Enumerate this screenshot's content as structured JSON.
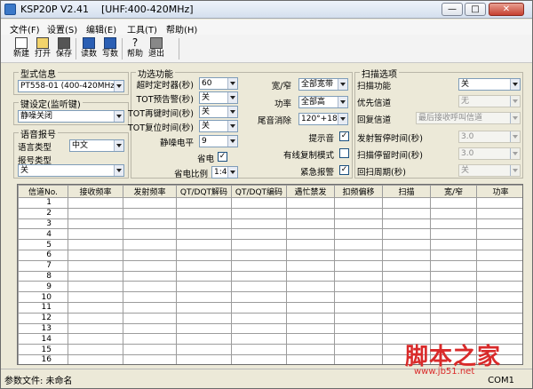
{
  "window": {
    "title": "KSP20P V2.41    [UHF:400-420MHz]",
    "min_label": "—",
    "max_label": "□",
    "close_label": "✕"
  },
  "menu": [
    "文件(F)",
    "设置(S)",
    "编辑(E)",
    "工具(T)",
    "帮助(H)"
  ],
  "toolbar": {
    "new": "新建",
    "open": "打开",
    "save": "保存",
    "read": "读数",
    "write": "写数",
    "help": "帮助",
    "exit": "退出"
  },
  "model": {
    "title": "型式信息",
    "value": "PT558-01 (400-420MHz)"
  },
  "key": {
    "title": "键设定(监听键)",
    "value": "静噪关闭"
  },
  "voice": {
    "title": "语音报号",
    "lang_label": "语言类型",
    "lang_value": "中文",
    "report_label": "报号类型",
    "report_value": "关"
  },
  "func": {
    "title": "功选功能",
    "timeout_label": "超时定时器(秒)",
    "timeout_value": "60",
    "tot_prealert_label": "TOT预告警(秒)",
    "tot_prealert_value": "关",
    "tot_rekey_label": "TOT再键时间(秒)",
    "tot_rekey_value": "关",
    "tot_reset_label": "TOT复位时间(秒)",
    "tot_reset_value": "关",
    "squelch_label": "静噪电平",
    "squelch_value": "9",
    "powersave_label": "省电",
    "powersave_checked": true,
    "ratio_label": "省电比例",
    "ratio_value": "1:4",
    "bw_label": "宽/窄",
    "bw_value": "全部宽带",
    "power_label": "功率",
    "power_value": "全部高",
    "tail_label": "尾音消除",
    "tail_value": "120°+180°",
    "beep_label": "提示音",
    "beep_checked": true,
    "clone_label": "有线复制模式",
    "clone_checked": false,
    "alarm_label": "紧急报警",
    "alarm_checked": true
  },
  "scan": {
    "title": "扫描选项",
    "func_label": "扫描功能",
    "func_value": "关",
    "priority_label": "优先信道",
    "priority_value": "无",
    "revert_label": "回复信道",
    "revert_value": "最后接收呼叫信道",
    "tx_pause_label": "发射暂停时间(秒)",
    "tx_pause_value": "3.0",
    "rx_pause_label": "扫描停留时间(秒)",
    "rx_pause_value": "3.0",
    "lookback_label": "回扫周期(秒)",
    "lookback_value": "关"
  },
  "table": {
    "columns": [
      "信道No.",
      "接收频率",
      "发射频率",
      "QT/DQT解码",
      "QT/DQT编码",
      "遇忙禁发",
      "扣频偏移",
      "扫描",
      "宽/窄",
      "功率"
    ],
    "rows": [
      "1",
      "2",
      "3",
      "4",
      "5",
      "6",
      "7",
      "8",
      "9",
      "10",
      "11",
      "12",
      "13",
      "14",
      "15",
      "16"
    ]
  },
  "status": {
    "file": "参数文件: 未命名",
    "port": "COM1"
  },
  "watermark": {
    "big": "脚本之家",
    "small": "www.jb51.net"
  }
}
